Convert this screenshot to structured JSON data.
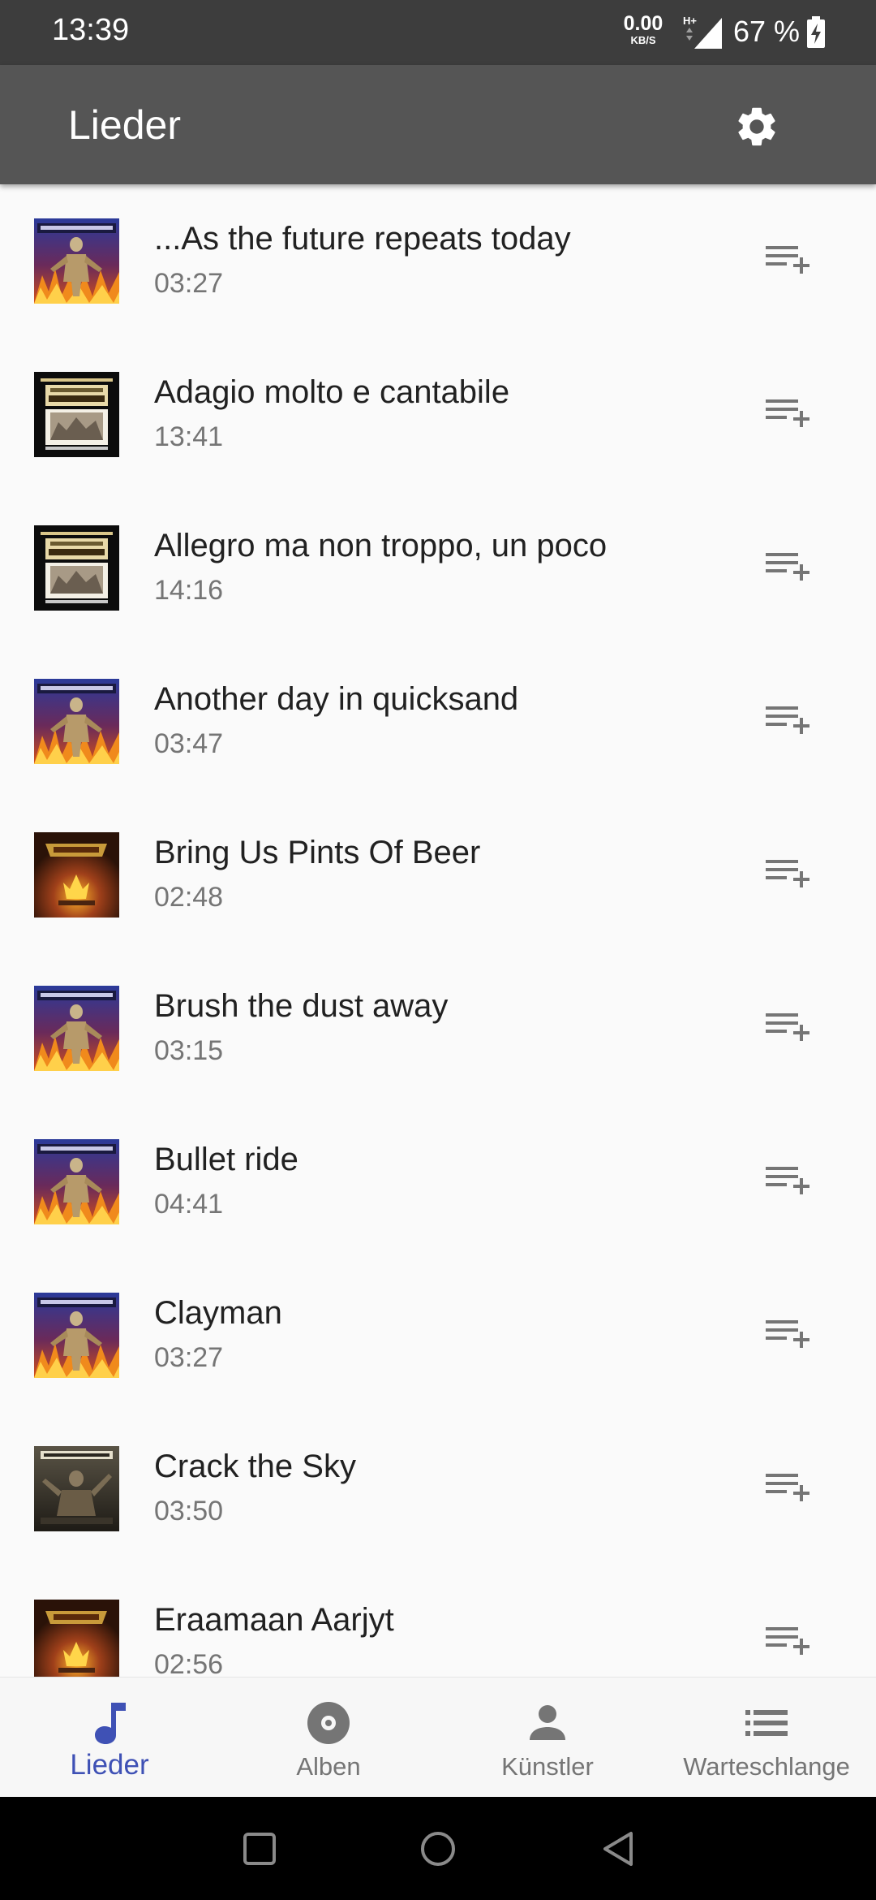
{
  "status_bar": {
    "time": "13:39",
    "net_speed": "0.00",
    "net_unit": "KB/S",
    "network_type": "H+",
    "battery_percent": "67 %"
  },
  "app_bar": {
    "title": "Lieder",
    "settings_icon": "gear-icon"
  },
  "songs": [
    {
      "title": "...As the future repeats today",
      "duration": "03:27",
      "cover": "in-flames-cover"
    },
    {
      "title": "Adagio molto e cantabile",
      "duration": "13:41",
      "cover": "beethoven-cover"
    },
    {
      "title": "Allegro ma non troppo, un poco",
      "duration": "14:16",
      "cover": "beethoven-cover"
    },
    {
      "title": "Another day in quicksand",
      "duration": "03:47",
      "cover": "in-flames-cover"
    },
    {
      "title": "Bring Us Pints Of Beer",
      "duration": "02:48",
      "cover": "korpiklaani-cover"
    },
    {
      "title": "Brush the dust away",
      "duration": "03:15",
      "cover": "in-flames-cover"
    },
    {
      "title": "Bullet ride",
      "duration": "04:41",
      "cover": "in-flames-cover"
    },
    {
      "title": "Clayman",
      "duration": "03:27",
      "cover": "in-flames-cover"
    },
    {
      "title": "Crack the Sky",
      "duration": "03:50",
      "cover": "amon-amarth-cover"
    },
    {
      "title": "Eraamaan Aarjyt",
      "duration": "02:56",
      "cover": "korpiklaani-cover"
    }
  ],
  "add_to_queue_icon": "playlist-add-icon",
  "bottom_nav": {
    "active": "songs",
    "items": [
      {
        "label": "Lieder",
        "icon": "music-note-icon"
      },
      {
        "label": "Alben",
        "icon": "album-icon"
      },
      {
        "label": "Künstler",
        "icon": "person-icon"
      },
      {
        "label": "Warteschlange",
        "icon": "queue-list-icon"
      }
    ]
  },
  "colors": {
    "status_bar": "#3d3d3d",
    "app_bar": "#555555",
    "accent": "#3f51b5",
    "background": "#fafafa"
  }
}
